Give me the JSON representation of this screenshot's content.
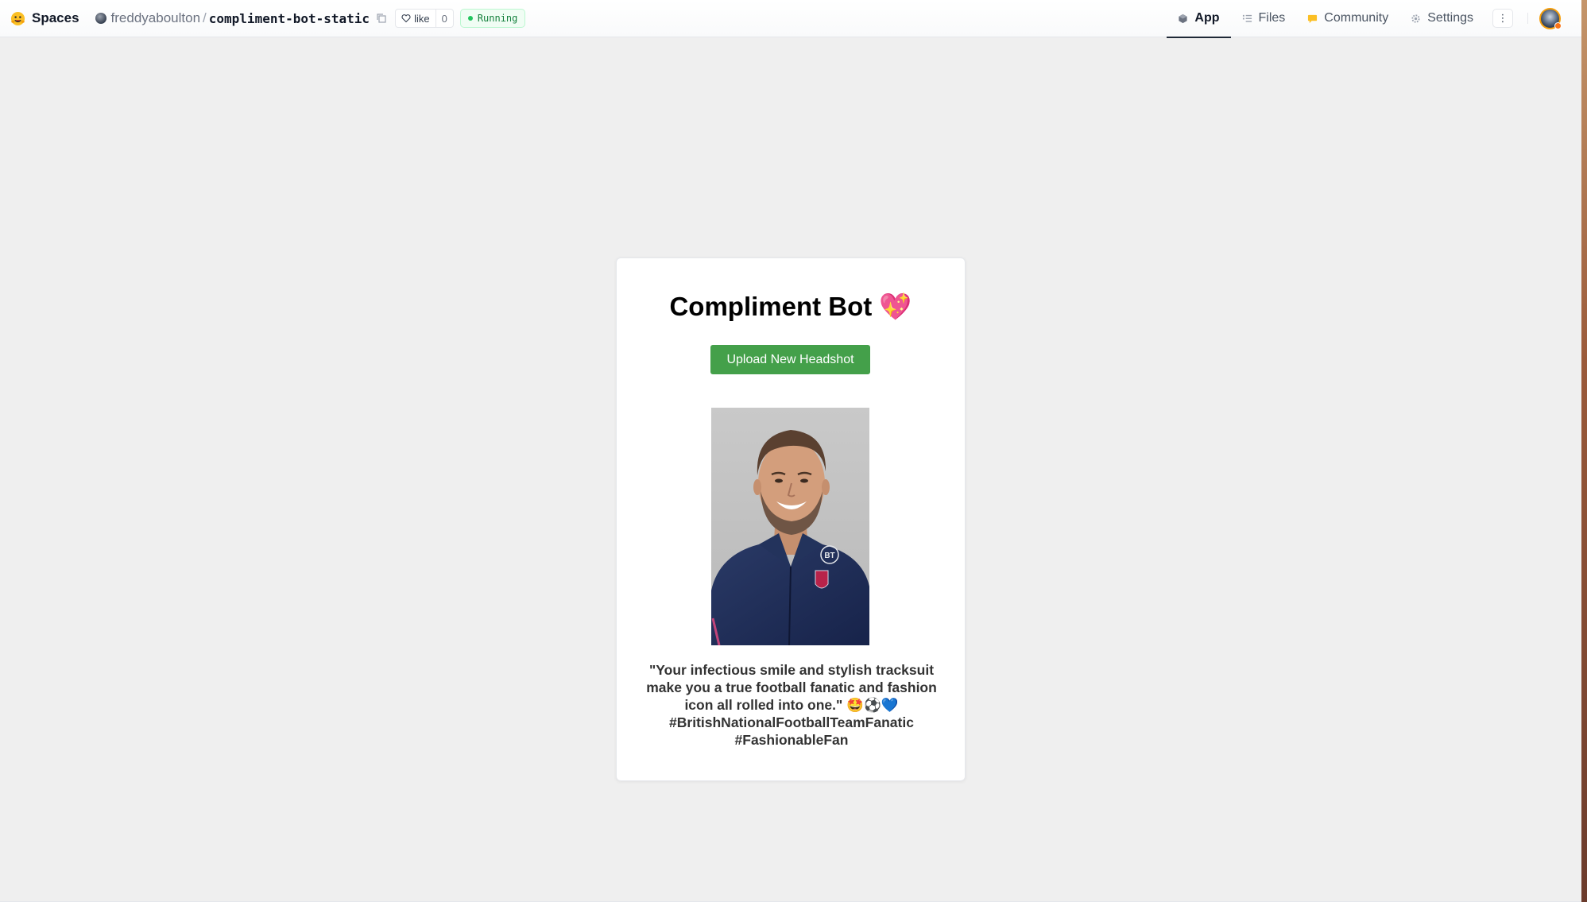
{
  "header": {
    "spaces_label": "Spaces",
    "owner": "freddyaboulton",
    "separator": "/",
    "repo_name": "compliment-bot-static",
    "like_label": "like",
    "like_count": "0",
    "status": "Running"
  },
  "nav": {
    "tabs": [
      {
        "label": "App",
        "icon": "app-cube-icon",
        "active": true
      },
      {
        "label": "Files",
        "icon": "files-icon",
        "active": false
      },
      {
        "label": "Community",
        "icon": "community-icon",
        "active": false
      },
      {
        "label": "Settings",
        "icon": "gear-icon",
        "active": false
      }
    ],
    "more_label": "⋮"
  },
  "app": {
    "title": "Compliment Bot 💖",
    "upload_button": "Upload New Headshot",
    "compliment": "\"Your infectious smile and stylish tracksuit make you a true football fanatic and fashion icon all rolled into one.\" 🤩⚽💙 #BritishNationalFootballTeamFanatic #FashionableFan"
  },
  "colors": {
    "page_bg": "#efefef",
    "button_green": "#44a04a",
    "status_green": "#15803d",
    "jacket_navy": "#1e2d52"
  }
}
